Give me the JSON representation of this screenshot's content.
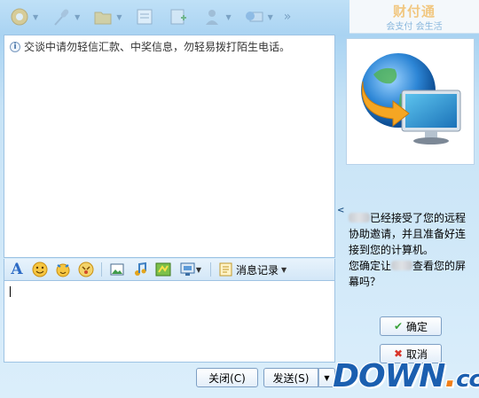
{
  "toolbar": {
    "items": [
      {
        "name": "video-icon"
      },
      {
        "name": "voice-icon"
      },
      {
        "name": "folder-icon"
      },
      {
        "name": "document-icon"
      },
      {
        "name": "app-plus-icon"
      },
      {
        "name": "user-icon"
      },
      {
        "name": "remote-assist-icon"
      }
    ],
    "more": "»"
  },
  "logo": {
    "main": "财付通",
    "sub": "会支付 会生活"
  },
  "chat": {
    "notice": "交谈中请勿轻信汇款、中奖信息，勿轻易拨打陌生电话。"
  },
  "format_bar": {
    "font_label": "A",
    "history_label": "消息记录",
    "icons": [
      "font-icon",
      "emoji-smile-icon",
      "magic-emoji-icon",
      "emoji-game-icon",
      "image-icon",
      "music-icon",
      "scrawl-icon",
      "screenshot-icon",
      "history-icon"
    ]
  },
  "buttons": {
    "close": "关闭(C)",
    "send": "发送(S)",
    "send_dropdown": "▼",
    "confirm": "确定",
    "cancel": "取消"
  },
  "remote_assist": {
    "line1_suffix": "已经接受了您的远程协助邀请，并且准备好连接到您的计算机。",
    "line2_prefix": "您确定让",
    "line2_suffix": "查看您的屏幕吗？"
  },
  "watermark": {
    "text": "DOWN",
    "dot": ".",
    "tld": "cc"
  },
  "colors": {
    "accent": "#1b5fb0",
    "orange": "#f07f1a",
    "border": "#9ec3e3"
  }
}
